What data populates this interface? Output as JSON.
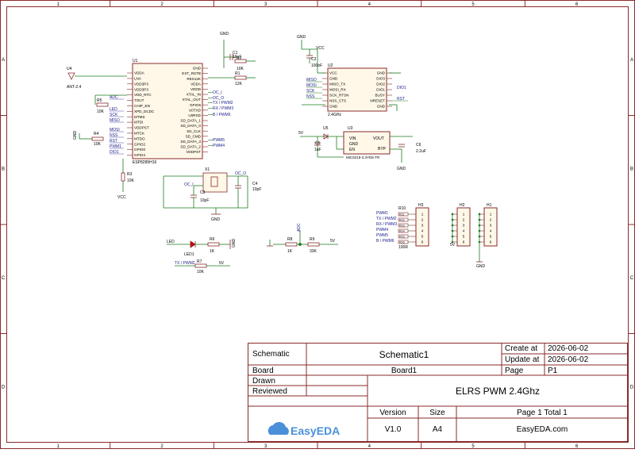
{
  "frame": {
    "col_labels": [
      "1",
      "2",
      "3",
      "4",
      "5",
      "6"
    ],
    "row_labels": [
      "A",
      "B",
      "C",
      "D"
    ]
  },
  "title_block": {
    "schematic_label": "Schematic",
    "schematic_name": "Schematic1",
    "create_label": "Create at",
    "create_date": "2026-06-02",
    "update_label": "Update at",
    "update_date": "2026-06-02",
    "board_label": "Board",
    "board_name": "Board1",
    "page_label": "Page",
    "page_value": "P1",
    "drawn_label": "Drawn",
    "reviewed_label": "Reviewed",
    "project_title": "ELRS PWM 2.4Ghz",
    "version_label": "Version",
    "version_value": "V1.0",
    "size_label": "Size",
    "size_value": "A4",
    "page_total": "Page  1  Total  1",
    "logo_text": "EasyEDA",
    "website": "EasyEDA.com"
  },
  "u1": {
    "ref": "U1",
    "part": "ESP8285H16",
    "left_pins": [
      "VDDA",
      "LNA",
      "VDD3P3",
      "VDD3P3",
      "VDD_RTC",
      "TOUT",
      "CHIP_EN",
      "XPD_DCDC",
      "MTMS",
      "MTDI",
      "VDDPST",
      "MTCK",
      "MTDO",
      "GPIO2",
      "GPIO0",
      "GPIO4"
    ],
    "right_pins": [
      "GND",
      "EXT_RSTB",
      "RES12K",
      "VDDA",
      "VDDD",
      "XTAL_IN",
      "XTAL_OUT",
      "GPIO5",
      "U0TXD",
      "U0RXD",
      "SD_DATA_1",
      "SD_DATA_0",
      "SD_CLK",
      "SD_CMD",
      "SD_DATA_3",
      "SD_DATA_2",
      "VDDPST"
    ],
    "left_nets": [
      "ADC",
      "LED",
      "SCK",
      "MISO",
      "MOSI",
      "NSS",
      "RST",
      "PWM1",
      "DIO1"
    ],
    "right_nets": [
      "OC_I",
      "OC_O",
      "TX / PWM2",
      "RX / PWM3",
      "B / PWM6",
      "PWM5",
      "PWM4"
    ]
  },
  "u2": {
    "ref": "U2",
    "part": "2.4GHz",
    "left_pins": [
      "VCC",
      "GND",
      "MISO_TX",
      "MOSI_RX",
      "SCK_RTSN",
      "NSS_CTS",
      "GND"
    ],
    "right_pins": [
      "GND",
      "DIO3",
      "DIO2",
      "DIO1",
      "BUSY",
      "NRESET",
      "GND"
    ],
    "left_nets": [
      "MISO",
      "MOSI",
      "SCK",
      "NSS"
    ],
    "right_nets": [
      "DIO1",
      "RST"
    ]
  },
  "u3": {
    "ref": "U3",
    "part": "MIC5219-3.3YD5-TR",
    "left_pins": [
      "VIN",
      "GND",
      "EN"
    ],
    "right_pins": [
      "VOUT",
      "BYP"
    ],
    "input_net": "5V"
  },
  "u4": {
    "ref": "U4",
    "part": "ANT-2.4"
  },
  "u5": {
    "ref": "U5"
  },
  "x1": {
    "ref": "X1",
    "left_net": "OC_I",
    "right_net": "OC_O"
  },
  "components": {
    "c1": {
      "ref": "C1",
      "value": "10uF"
    },
    "c2": {
      "ref": "C2",
      "value": "100nF"
    },
    "c3": {
      "ref": "C3",
      "value": "10pF"
    },
    "c4": {
      "ref": "C4",
      "value": "10pF"
    },
    "c5": {
      "ref": "C5",
      "value": "1uF"
    },
    "c6": {
      "ref": "C6",
      "value": "2.2uF"
    },
    "r1": {
      "ref": "R1",
      "value": "12K"
    },
    "r2": {
      "ref": "R2",
      "value": "10K"
    },
    "r3": {
      "ref": "R3",
      "value": "10K"
    },
    "r4": {
      "ref": "R4",
      "value": "10K"
    },
    "r5": {
      "ref": "R5",
      "value": "10K"
    },
    "r6": {
      "ref": "R6",
      "value": "1K"
    },
    "r7": {
      "ref": "R7",
      "value": "10K"
    },
    "r8": {
      "ref": "R8",
      "value": "1K"
    },
    "r9": {
      "ref": "R9",
      "value": "33K"
    },
    "r10": {
      "ref": "R10",
      "value": "100R"
    },
    "led1": {
      "ref": "LED1",
      "net": "LED"
    }
  },
  "labels": {
    "gnd": "GND",
    "vcc": "VCC",
    "v5": "5V",
    "adc": "ADC",
    "rst": "RST",
    "tx_pwm2": "TX / PWM2"
  },
  "headers": {
    "h1": {
      "ref": "H1",
      "pins": [
        "1",
        "2",
        "3",
        "4",
        "5",
        "6"
      ]
    },
    "h2": {
      "ref": "H2",
      "pins": [
        "1",
        "2",
        "3",
        "4",
        "5",
        "6"
      ]
    },
    "h3": {
      "ref": "H3",
      "pins": [
        "1",
        "2",
        "3",
        "4",
        "5",
        "6"
      ]
    },
    "h3_nets": [
      "PWM1",
      "TX / PWM2",
      "RX / PWM3",
      "PWM4",
      "PWM5",
      "B / PWM6"
    ],
    "h3_resistors": [
      "R11",
      "R12",
      "R13",
      "R14",
      "R15",
      "R16"
    ],
    "h2_net": "5V"
  }
}
